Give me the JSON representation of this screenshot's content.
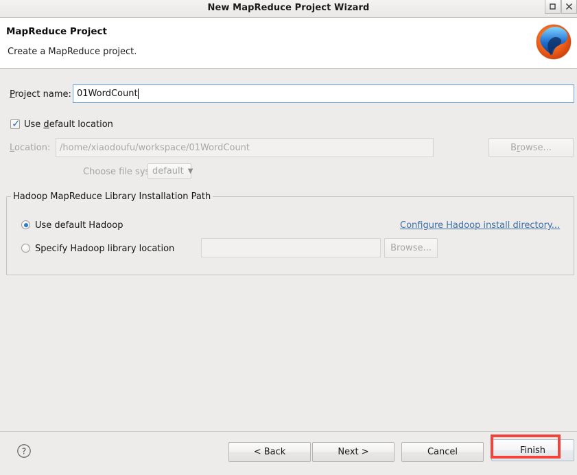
{
  "window": {
    "title": "New MapReduce Project Wizard",
    "buttons": [
      {
        "name": "maximize-button",
        "glyph": "▣"
      },
      {
        "name": "close-button",
        "glyph": "✕"
      }
    ]
  },
  "header": {
    "title": "MapReduce Project",
    "subtitle": "Create a MapReduce project.",
    "logo": "hadoop-elephant-logo"
  },
  "form": {
    "project_name_label_pre": "",
    "project_name_label": "Project name:",
    "project_name_mnemonic": "P",
    "project_name_value": "01WordCount",
    "use_default_location_label": "Use default location",
    "use_default_location_mnemonic": "d",
    "use_default_location_checked": true,
    "location_label": "Location:",
    "location_mnemonic": "L",
    "location_value": "/home/xiaodoufu/workspace/01WordCount",
    "location_browse_label": "Browse...",
    "location_browse_mnemonic": "r",
    "choose_file_system_label": "Choose file system:",
    "file_system_value": "default",
    "file_system_options": [
      "default"
    ]
  },
  "hadoop_group": {
    "title": "Hadoop MapReduce Library Installation Path",
    "option_default_label": "Use default Hadoop",
    "option_default_selected": true,
    "option_specify_label": "Specify Hadoop library location",
    "option_specify_selected": false,
    "library_path_value": "",
    "library_browse_label": "Browse...",
    "configure_link_label": "Configure Hadoop install directory..."
  },
  "footer": {
    "help_icon": "question-mark-icon",
    "back_label": "< Back",
    "next_label": "Next >",
    "cancel_label": "Cancel",
    "finish_label": "Finish"
  },
  "annotation": {
    "target": "finish-button",
    "color": "#f0443c"
  },
  "colors": {
    "accent_link": "#3a6ea5",
    "radio_selected": "#2b7ccc",
    "check_mark": "#2f6fb5",
    "highlight": "#f0443c",
    "body_bg": "#edeceb",
    "header_bg": "#ffffff"
  }
}
